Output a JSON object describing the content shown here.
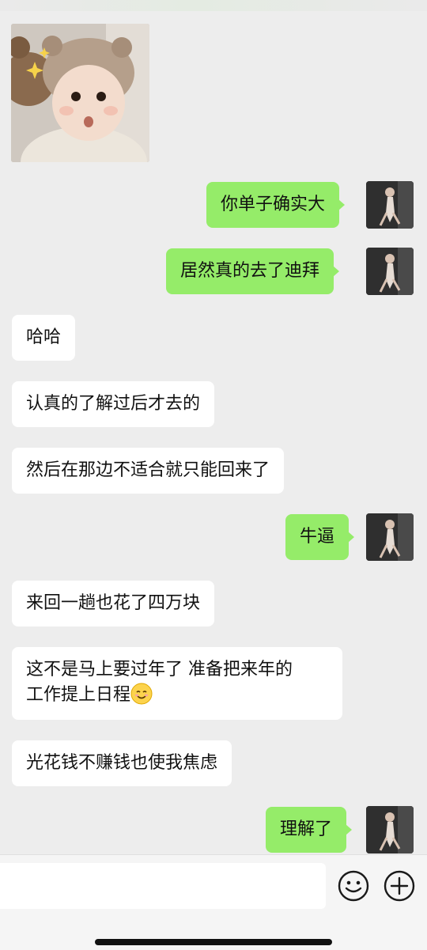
{
  "chat": {
    "image_message": {
      "alt": "baby-photo"
    },
    "messages": [
      {
        "side": "out",
        "text": "你单子确实大"
      },
      {
        "side": "out",
        "text": "居然真的去了迪拜"
      },
      {
        "side": "in",
        "text": "哈哈"
      },
      {
        "side": "in",
        "text": "认真的了解过后才去的"
      },
      {
        "side": "in",
        "text": "然后在那边不适合就只能回来了"
      },
      {
        "side": "out",
        "text": "牛逼"
      },
      {
        "side": "in",
        "text": "来回一趟也花了四万块"
      },
      {
        "side": "in",
        "line1": "这不是马上要过年了 准备把来年的",
        "line2": "工作提上日程",
        "emoji": "smiling-face-emoji"
      },
      {
        "side": "in",
        "text": "光花钱不赚钱也使我焦虑"
      },
      {
        "side": "out",
        "text": "理解了"
      }
    ]
  },
  "input_bar": {
    "placeholder": "",
    "icons": [
      "emoji-icon",
      "plus-icon"
    ]
  },
  "colors": {
    "background": "#ededed",
    "incoming_bubble": "#ffffff",
    "outgoing_bubble": "#95ec69"
  }
}
